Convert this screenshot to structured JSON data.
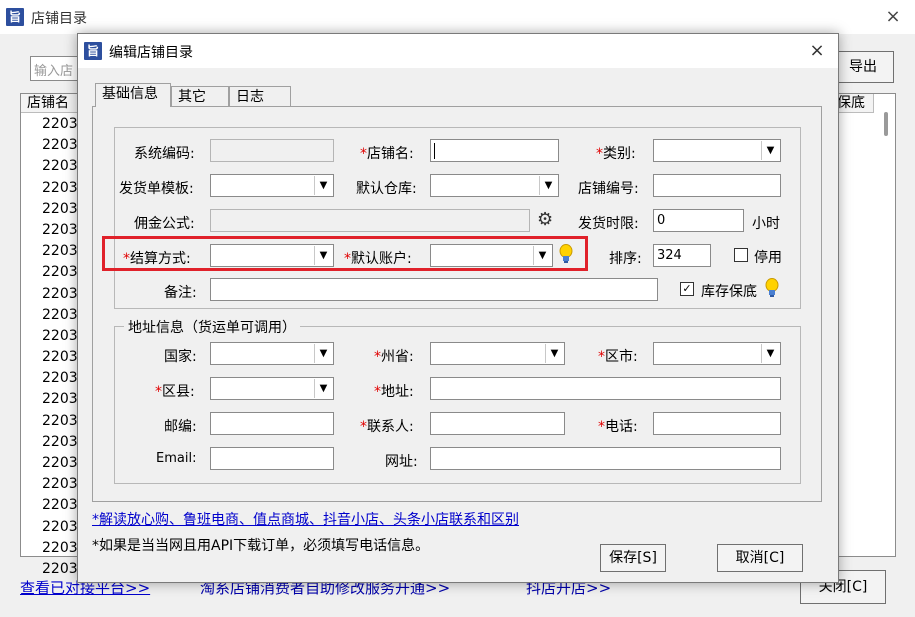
{
  "parent": {
    "title": "店铺目录",
    "icon_char": "旨",
    "search_placeholder": "输入店",
    "export_label": "导出",
    "col_name": "店铺名",
    "col_baodi": "保底",
    "rows": [
      "22033",
      "22033",
      "22033",
      "22033",
      "22033",
      "22033",
      "22033",
      "22033",
      "22033",
      "22033",
      "22033",
      "22033",
      "22033",
      "22033",
      "22033",
      "22033",
      "22033",
      "22033",
      "22033",
      "22033",
      "22033",
      "22033"
    ],
    "link_platforms": "查看已对接平台>>",
    "link_service": "淘系店铺消费者自助修改服务开通>>",
    "link_douyin": "抖店开店>>",
    "close_label": "关闭[C]",
    "close_icon": "×"
  },
  "dialog": {
    "title": "编辑店铺目录",
    "icon_char": "旨",
    "close_icon": "×",
    "tabs": [
      "基础信息",
      "其它",
      "日志"
    ],
    "basic": {
      "system_code_label": "系统编码:",
      "shop_name_label": "店铺名:",
      "category_label": "类别:",
      "ship_template_label": "发货单模板:",
      "default_warehouse_label": "默认仓库:",
      "shop_no_label": "店铺编号:",
      "commission_label": "佣金公式:",
      "ship_limit_label": "发货时限:",
      "ship_limit_value": "0",
      "ship_limit_unit": "小时",
      "settlement_label": "结算方式:",
      "default_account_label": "默认账户:",
      "sort_label": "排序:",
      "sort_value": "324",
      "disable_label": "停用",
      "remark_label": "备注:",
      "stock_baodi_label": "库存保底",
      "stock_baodi_checked": "✓"
    },
    "address": {
      "group_title": "地址信息（货运单可调用）",
      "country_label": "国家:",
      "province_label": "州省:",
      "city_label": "区市:",
      "county_label": "区县:",
      "address_label": "地址:",
      "postcode_label": "邮编:",
      "contact_label": "联系人:",
      "phone_label": "电话:",
      "email_label": "Email:",
      "website_label": "网址:"
    },
    "required_mark": "*",
    "link_text": "*解读放心购、鲁班电商、值点商城、抖音小店、头条小店联系和区别",
    "note_text": "*如果是当当网且用API下载订单，必须填写电话信息。",
    "save_label": "保存[S]",
    "cancel_label": "取消[C]",
    "dropdown_arrow": "▼",
    "gear_icon": "⚙"
  },
  "colors": {
    "required": "#e00000",
    "highlight": "#e0212a",
    "link": "#0000cc"
  }
}
